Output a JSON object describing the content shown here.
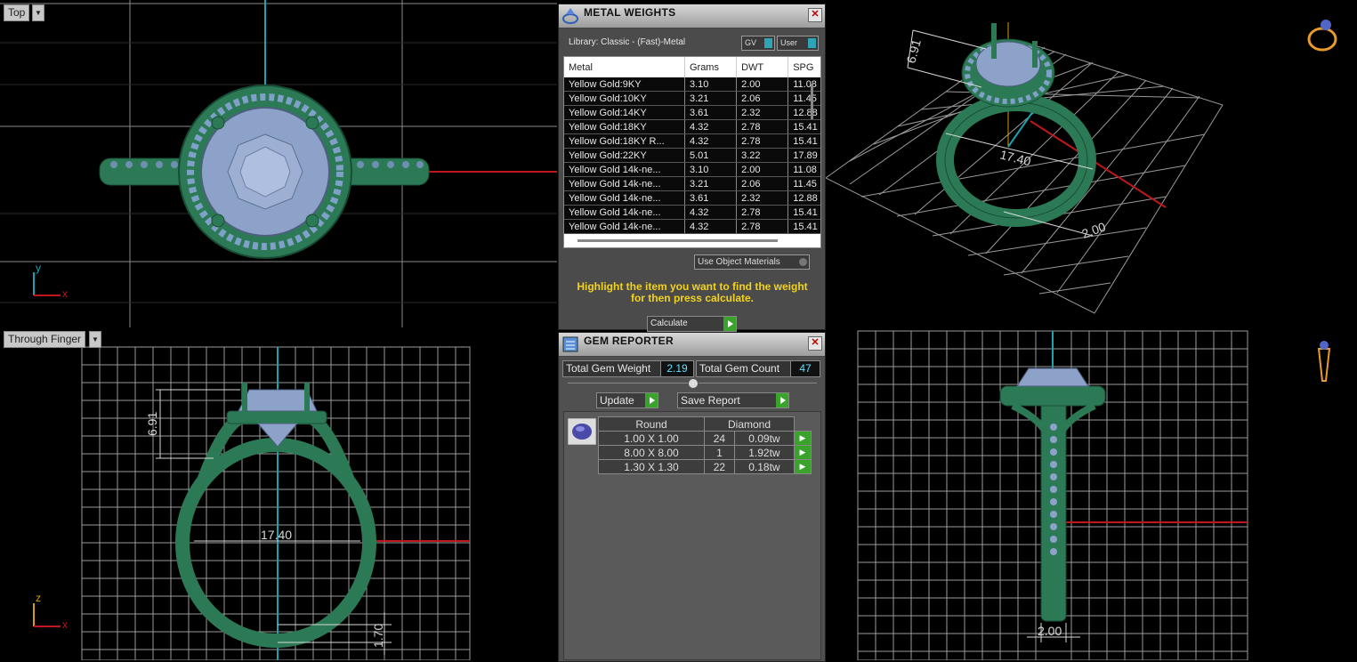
{
  "viewports": {
    "top": {
      "label": "Top",
      "axis_y": "y",
      "axis_x": "x"
    },
    "perspective": {
      "dim_height": "6.91",
      "dim_width": "17.40",
      "dim_small": "2.00"
    },
    "front": {
      "label": "Through Finger",
      "axis_z": "z",
      "axis_x": "x",
      "dim_height": "6.91",
      "dim_width": "17.40",
      "dim_band": "1.70"
    },
    "side": {
      "dim_width": "2.00"
    }
  },
  "metal_weights": {
    "title": "METAL WEIGHTS",
    "library": "Library: Classic - (Fast)-Metal",
    "toggle_gv": "GV",
    "toggle_user": "User",
    "columns": [
      "Metal",
      "Grams",
      "DWT",
      "SPG"
    ],
    "rows": [
      [
        "Yellow Gold:9KY",
        "3.10",
        "2.00",
        "11.08"
      ],
      [
        "Yellow Gold:10KY",
        "3.21",
        "2.06",
        "11.45"
      ],
      [
        "Yellow Gold:14KY",
        "3.61",
        "2.32",
        "12.88"
      ],
      [
        "Yellow Gold:18KY",
        "4.32",
        "2.78",
        "15.41"
      ],
      [
        "Yellow Gold:18KY R...",
        "4.32",
        "2.78",
        "15.41"
      ],
      [
        "Yellow Gold:22KY",
        "5.01",
        "3.22",
        "17.89"
      ],
      [
        "Yellow Gold 14k-ne...",
        "3.10",
        "2.00",
        "11.08"
      ],
      [
        "Yellow Gold 14k-ne...",
        "3.21",
        "2.06",
        "11.45"
      ],
      [
        "Yellow Gold 14k-ne...",
        "3.61",
        "2.32",
        "12.88"
      ],
      [
        "Yellow Gold 14k-ne...",
        "4.32",
        "2.78",
        "15.41"
      ],
      [
        "Yellow Gold 14k-ne...",
        "4.32",
        "2.78",
        "15.41"
      ]
    ],
    "use_object_materials": "Use Object Materials",
    "message_line1": "Highlight the item you want to find the weight",
    "message_line2": "for then press calculate.",
    "calculate": "Calculate"
  },
  "gem_reporter": {
    "title": "GEM REPORTER",
    "total_weight_label": "Total Gem Weight",
    "total_weight_value": "2.19",
    "total_count_label": "Total Gem Count",
    "total_count_value": "47",
    "update": "Update",
    "save_report": "Save Report",
    "header_shape": "Round",
    "header_type": "Diamond",
    "rows": [
      [
        "1.00 X 1.00",
        "24",
        "0.09tw"
      ],
      [
        "8.00 X 8.00",
        "1",
        "1.92tw"
      ],
      [
        "1.30 X 1.30",
        "22",
        "0.18tw"
      ]
    ]
  },
  "colors": {
    "ring": "#2c7a55",
    "gem": "#8da2c8",
    "grid": "#cfcfcf",
    "x_axis": "#c0161c",
    "y_axis": "#1aa3b0"
  }
}
